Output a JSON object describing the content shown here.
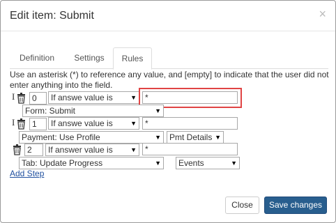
{
  "dialog": {
    "title": "Edit item: Submit",
    "close_glyph": "×"
  },
  "tabs": [
    {
      "label": "Definition"
    },
    {
      "label": "Settings"
    },
    {
      "label": "Rules"
    }
  ],
  "description": "Use an asterisk (*) to reference any value, and [empty] to indicate that the user did not enter anything into the field.",
  "rules": [
    {
      "step": "0",
      "condition": "If answe value is",
      "value": "*",
      "action": "Form: Submit"
    },
    {
      "step": "1",
      "condition": "If answe value is",
      "value": "*",
      "action": "Payment: Use Profile",
      "extra": "Pmt Details"
    },
    {
      "step": "2",
      "condition": "If answer value is",
      "value": "*",
      "action": "Tab: Update Progress",
      "extra": "Events"
    }
  ],
  "add_step_label": "Add Step",
  "footer": {
    "close_label": "Close",
    "save_label": "Save changes"
  },
  "colors": {
    "primary": "#285e8e",
    "highlight": "#e04444",
    "link": "#1f4f9f"
  },
  "icons": [
    "trash-icon",
    "text-cursor-icon",
    "chevron-down-icon",
    "close-icon"
  ]
}
